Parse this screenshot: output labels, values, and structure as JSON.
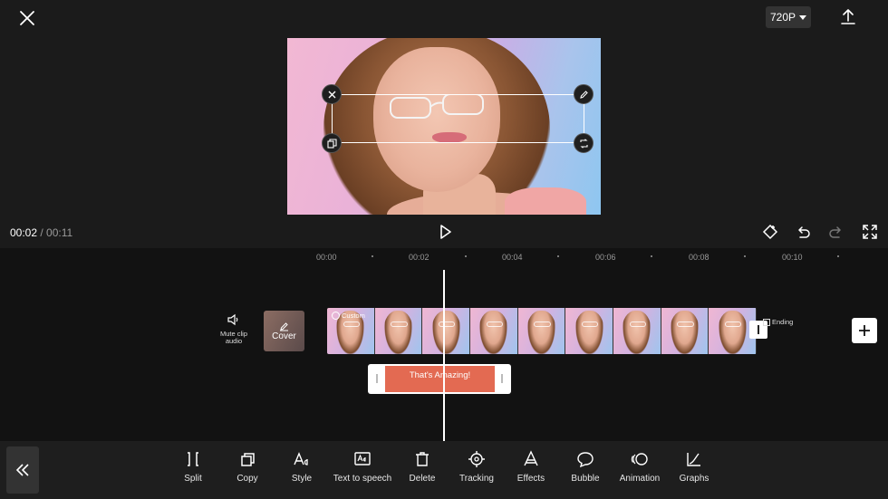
{
  "header": {
    "close_icon": "close-icon",
    "resolution_label": "720P",
    "export_icon": "upload-icon"
  },
  "player": {
    "current_time": "00:02",
    "separator": " / ",
    "total_time": "00:11",
    "play_icon": "play-icon",
    "keyframe_icon": "keyframe-icon",
    "undo_icon": "undo-icon",
    "redo_icon": "redo-icon",
    "fullscreen_icon": "fullscreen-icon"
  },
  "timeline": {
    "ticks": [
      "00:00",
      "00:02",
      "00:04",
      "00:06",
      "00:08",
      "00:10"
    ],
    "mute_label_line1": "Mute clip",
    "mute_label_line2": "audio",
    "cover_label": "Cover",
    "custom_tag": "Custom",
    "ending_label": "Ending",
    "text_clip_label": "That's Amazing!"
  },
  "toolbar": {
    "items": [
      {
        "label": "Split",
        "icon": "split-icon"
      },
      {
        "label": "Copy",
        "icon": "copy-icon"
      },
      {
        "label": "Style",
        "icon": "text-style-icon"
      },
      {
        "label": "Text to speech",
        "icon": "text-to-speech-icon"
      },
      {
        "label": "Delete",
        "icon": "trash-icon"
      },
      {
        "label": "Tracking",
        "icon": "tracking-icon"
      },
      {
        "label": "Effects",
        "icon": "effects-icon"
      },
      {
        "label": "Bubble",
        "icon": "bubble-icon"
      },
      {
        "label": "Animation",
        "icon": "animation-icon"
      },
      {
        "label": "Graphs",
        "icon": "graph-icon"
      }
    ]
  }
}
